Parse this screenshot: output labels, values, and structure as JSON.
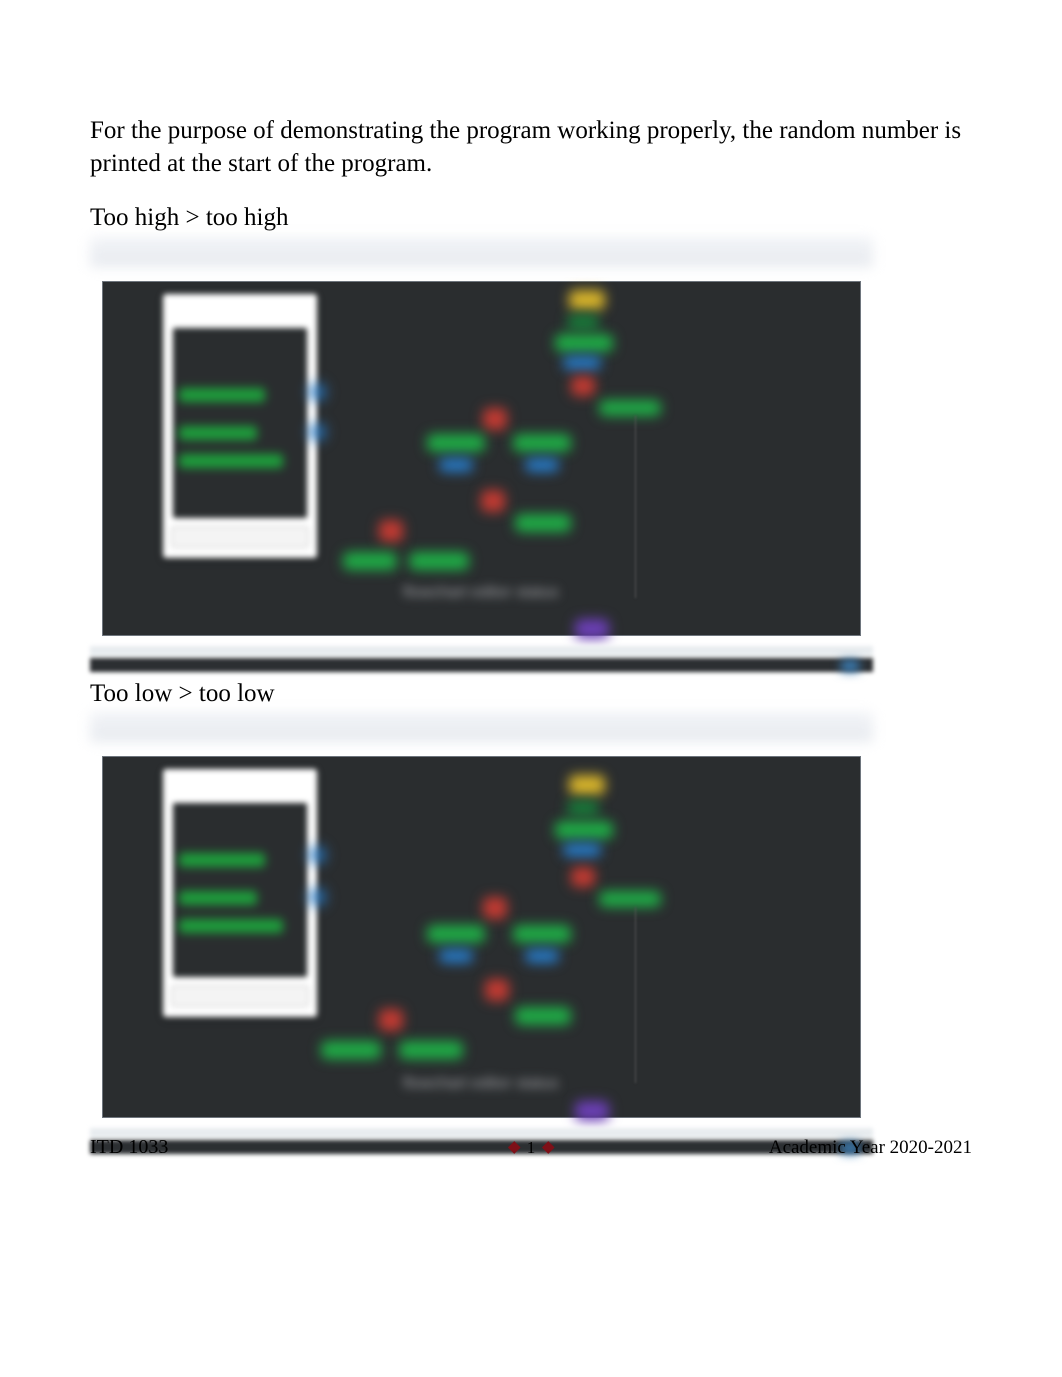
{
  "intro": "For the purpose of demonstrating the program working properly, the random number is printed at the start of the program.",
  "caption1": "Too high > too high",
  "caption2": "Too low > too low",
  "footer": {
    "left": "ITD 1033",
    "page": "1",
    "right": "Academic Year 2020-2021"
  },
  "screenshot": {
    "console_lines": [
      "output line",
      "prompt line",
      "status line"
    ],
    "bottom_label": "flowchart editor status"
  }
}
